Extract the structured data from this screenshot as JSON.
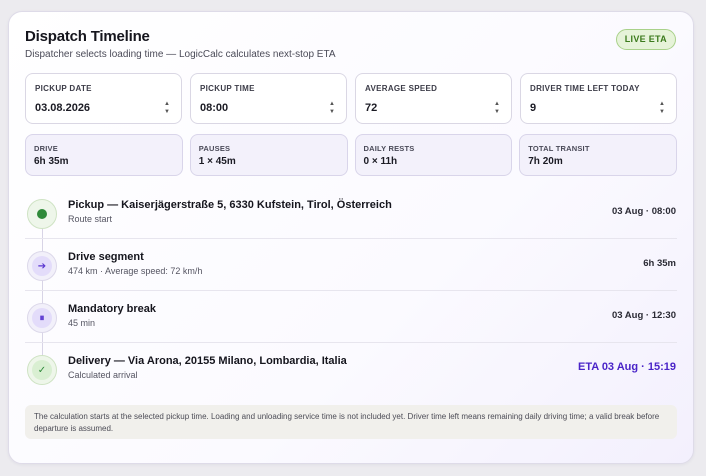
{
  "header": {
    "title": "Dispatch Timeline",
    "subtitle": "Dispatcher selects loading time — LogicCalc calculates next-stop ETA",
    "badge": "LIVE ETA"
  },
  "fields": [
    {
      "label": "PICKUP DATE",
      "value": "03.08.2026"
    },
    {
      "label": "PICKUP TIME",
      "value": "08:00"
    },
    {
      "label": "AVERAGE SPEED",
      "value": "72"
    },
    {
      "label": "DRIVER TIME LEFT TODAY",
      "value": "9"
    }
  ],
  "stats": [
    {
      "label": "DRIVE",
      "value": "6h 35m"
    },
    {
      "label": "PAUSES",
      "value": "1 × 45m"
    },
    {
      "label": "DAILY RESTS",
      "value": "0 × 11h"
    },
    {
      "label": "TOTAL TRANSIT",
      "value": "7h 20m"
    }
  ],
  "timeline": [
    {
      "icon": "dot-icon",
      "title": "Pickup — Kaiserjägerstraße 5, 6330 Kufstein, Tirol, Österreich",
      "sub": "Route start",
      "time": "03 Aug · 08:00"
    },
    {
      "icon": "arrow-right-icon",
      "glyph": "➔",
      "title": "Drive segment",
      "sub": "474 km · Average speed: 72 km/h",
      "time": "6h 35m"
    },
    {
      "icon": "pause-icon",
      "glyph": "⏸",
      "title": "Mandatory break",
      "sub": "45 min",
      "time": "03 Aug · 12:30"
    },
    {
      "icon": "check-icon",
      "glyph": "✓",
      "title": "Delivery — Via Arona, 20155 Milano, Lombardia, Italia",
      "sub": "Calculated arrival",
      "time": "ETA 03 Aug · 15:19"
    }
  ],
  "note": "The calculation starts at the selected pickup time. Loading and unloading service time is not included yet. Driver time left means remaining daily driving time; a valid break before departure is assumed.",
  "colors": {
    "accent": "#4a24c8",
    "live_green": "#3b7a1c",
    "node_green": "#2f8a3a"
  }
}
